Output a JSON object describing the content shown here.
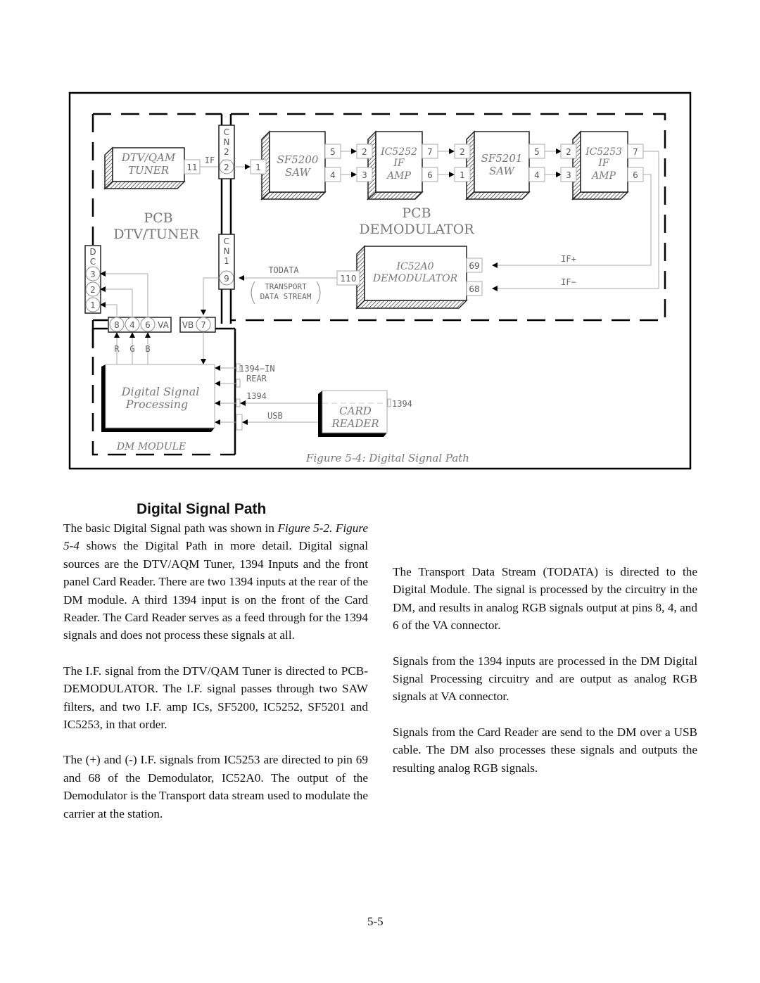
{
  "figure": {
    "caption": "Figure 5-4: Digital Signal Path",
    "pcb_tuner_label": [
      "PCB",
      "DTV/TUNER"
    ],
    "pcb_demod_label": [
      "PCB",
      "DEMODULATOR"
    ],
    "dm_module_label": "DM MODULE",
    "blocks": {
      "tuner": [
        "DTV/QAM",
        "TUNER"
      ],
      "sf5200": [
        "SF5200",
        "SAW"
      ],
      "ic5252": [
        "IC5252",
        "IF",
        "AMP"
      ],
      "sf5201": [
        "SF5201",
        "SAW"
      ],
      "ic5253": [
        "IC5253",
        "IF",
        "AMP"
      ],
      "ic52a0": [
        "IC52A0",
        "DEMODULATOR"
      ],
      "dsp": [
        "Digital Signal",
        "Processing"
      ],
      "card_reader": [
        "CARD",
        "READER"
      ]
    },
    "connectors": {
      "cn2": [
        "C",
        "N",
        "2"
      ],
      "cn2_pin": "2",
      "cn1": [
        "C",
        "N",
        "1"
      ],
      "cn1_pin": "9",
      "dc": [
        "D",
        "C"
      ],
      "dc_pins": [
        "3",
        "2",
        "1"
      ],
      "va_pins": [
        "8",
        "4",
        "6"
      ],
      "va_label": "VA",
      "vb_label": "VB",
      "vb_pin": "7"
    },
    "pins": {
      "tuner_out": "11",
      "sf5200_in": "1",
      "sf5200_out": [
        "5",
        "4"
      ],
      "ic5252_in": [
        "2",
        "3"
      ],
      "ic5252_out": [
        "7",
        "6"
      ],
      "sf5201_in": [
        "2",
        "1"
      ],
      "sf5201_out": [
        "5",
        "4"
      ],
      "ic5253_in": [
        "2",
        "3"
      ],
      "ic5253_out": [
        "7",
        "6"
      ],
      "ic52a0_in": [
        "69",
        "68"
      ],
      "ic52a0_out": "110"
    },
    "signals": {
      "if": "IF",
      "if_plus": "IF+",
      "if_minus": "IF−",
      "todata": "TODATA",
      "transport": [
        "TRANSPORT",
        "DATA STREAM"
      ],
      "rgb": [
        "R",
        "G",
        "B"
      ],
      "in_1394_rear": [
        "1394−IN",
        "REAR"
      ],
      "s1394": "1394",
      "usb": "USB",
      "card_1394": "1394"
    }
  },
  "article": {
    "heading": "Digital Signal Path",
    "p1_a": "The basic Digital Signal path was shown in ",
    "p1_fig1": "Figure 5-2.",
    "p1_b": " ",
    "p1_fig2": "Figure 5-4",
    "p1_c": " shows the Digital Path in more detail.  Digital signal sources are the DTV/AQM Tuner, 1394 Inputs and the front panel Card Reader.  There are two 1394 inputs at the rear of the DM module.  A third 1394 input is on the front of the Card Reader. The Card Reader serves as a feed through for the 1394 signals and does not process these signals at all.",
    "p2": "The I.F. signal from the DTV/QAM Tuner is directed to PCB-DEMODULATOR.  The I.F. signal passes through two SAW filters, and two I.F. amp ICs, SF5200, IC5252, SF5201 and IC5253, in that order.",
    "p3": "The (+) and (-) I.F. signals from IC5253 are directed to pin 69 and 68 of the Demodulator, IC52A0.  The output of the Demodulator is the Transport data stream used to modulate the carrier at the station.",
    "p4": "The Transport Data Stream (TODATA) is directed to the Digital Module.  The signal is processed by the circuitry in the DM, and results in analog RGB signals output at pins 8, 4, and 6 of the VA connector.",
    "p5": "Signals from the 1394 inputs are processed in the DM Digital Signal Processing circuitry and are output as analog RGB signals at VA connector.",
    "p6": "Signals from the Card Reader are send to the DM over a USB cable.  The DM also processes these signals and outputs the resulting analog RGB signals."
  },
  "page_number": "5-5"
}
